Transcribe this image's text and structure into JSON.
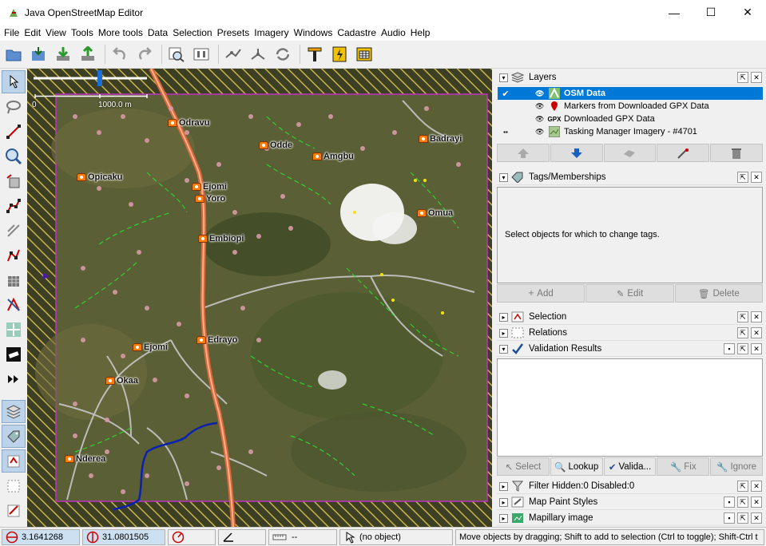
{
  "window": {
    "title": "Java OpenStreetMap Editor",
    "minimize": "—",
    "maximize": "☐",
    "close": "✕"
  },
  "menu": [
    "File",
    "Edit",
    "View",
    "Tools",
    "More tools",
    "Data",
    "Selection",
    "Presets",
    "Imagery",
    "Windows",
    "Cadastre",
    "Audio",
    "Help"
  ],
  "map": {
    "scale_zero": "0",
    "scale_label": "1000.0 m",
    "places": [
      {
        "name": "Odravu"
      },
      {
        "name": "Odde"
      },
      {
        "name": "Amgbu"
      },
      {
        "name": "Badrayi"
      },
      {
        "name": "Opicaku"
      },
      {
        "name": "Ejomi"
      },
      {
        "name": "Yoro"
      },
      {
        "name": "Omua"
      },
      {
        "name": "Embiopi"
      },
      {
        "name": "Ejomi"
      },
      {
        "name": "Edrayo"
      },
      {
        "name": "Okaa"
      },
      {
        "name": "Nderea"
      }
    ]
  },
  "layers_panel": {
    "title": "Layers",
    "layers": [
      {
        "name": "OSM Data",
        "active": true
      },
      {
        "name": "Markers from Downloaded GPX Data"
      },
      {
        "name": "Downloaded GPX Data",
        "icon_text": "GPX"
      },
      {
        "name": "Tasking Manager Imagery - #4701"
      }
    ]
  },
  "tags_panel": {
    "title": "Tags/Memberships",
    "empty_text": "Select objects for which to change tags.",
    "buttons": {
      "add": "Add",
      "edit": "Edit",
      "delete": "Delete"
    }
  },
  "selection_panel": {
    "title": "Selection"
  },
  "relations_panel": {
    "title": "Relations"
  },
  "validation_panel": {
    "title": "Validation Results",
    "buttons": {
      "select": "Select",
      "lookup": "Lookup",
      "validate": "Valida...",
      "fix": "Fix",
      "ignore": "Ignore"
    }
  },
  "filter_panel": {
    "title": "Filter Hidden:0 Disabled:0"
  },
  "mappaint_panel": {
    "title": "Map Paint Styles"
  },
  "mapillary_panel": {
    "title": "Mapillary image"
  },
  "status": {
    "lat": "3.1641268",
    "lon": "31.0801505",
    "angle": "",
    "distance": "--",
    "object": "(no object)",
    "help": "Move objects by dragging; Shift to add to selection (Ctrl to toggle); Shift-Ctrl t"
  }
}
